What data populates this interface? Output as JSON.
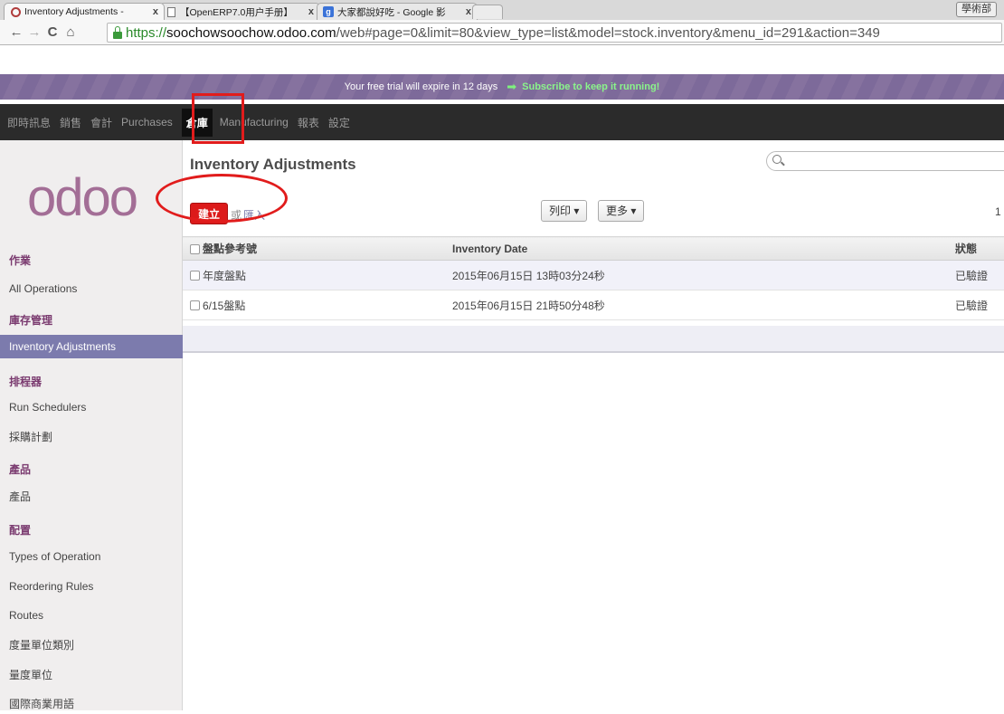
{
  "browser": {
    "tabs": [
      {
        "title": "Inventory Adjustments - ",
        "icon": "odoo-icon",
        "active": true
      },
      {
        "title": "【OpenERP7.0用户手册】",
        "icon": "document-icon",
        "active": false
      },
      {
        "title": "大家都說好吃 - Google 影",
        "icon": "google-icon",
        "active": false
      }
    ],
    "close_glyph": "x",
    "profile_badge": "學術部",
    "url": {
      "scheme": "https://",
      "host": "soochowsoochow.odoo.com",
      "path": "/web#page=0&limit=80&view_type=list&model=stock.inventory&menu_id=291&action=349"
    }
  },
  "trial": {
    "message": "Your free trial will expire in 12 days",
    "subscribe_label": "Subscribe to keep it running!"
  },
  "topmenu": [
    {
      "label": "即時訊息",
      "name": "menu-messaging"
    },
    {
      "label": "銷售",
      "name": "menu-sales"
    },
    {
      "label": "會計",
      "name": "menu-accounting"
    },
    {
      "label": "Purchases",
      "name": "menu-purchases"
    },
    {
      "label": "倉庫",
      "name": "menu-warehouse",
      "active": true
    },
    {
      "label": "Manufacturing",
      "name": "menu-manufacturing"
    },
    {
      "label": "報表",
      "name": "menu-reports"
    },
    {
      "label": "設定",
      "name": "menu-settings"
    }
  ],
  "sidebar": {
    "logo": "odoo",
    "sections": [
      {
        "title": "作業",
        "items": [
          {
            "label": "All Operations"
          }
        ]
      },
      {
        "title": "庫存管理",
        "items": [
          {
            "label": "Inventory Adjustments",
            "active": true
          }
        ]
      },
      {
        "title": "排程器",
        "items": [
          {
            "label": "Run Schedulers"
          },
          {
            "label": "採購計劃"
          }
        ]
      },
      {
        "title": "產品",
        "items": [
          {
            "label": "產品"
          }
        ]
      },
      {
        "title": "配置",
        "items": [
          {
            "label": "Types of Operation"
          },
          {
            "label": "Reordering Rules"
          },
          {
            "label": "Routes"
          },
          {
            "label": "度量單位類別"
          },
          {
            "label": "量度單位"
          },
          {
            "label": "國際商業用語"
          }
        ]
      }
    ]
  },
  "main": {
    "title": "Inventory Adjustments",
    "search_placeholder": "",
    "create_label": "建立",
    "or_label": "或",
    "import_label": "匯入",
    "print_label": "列印 ▾",
    "more_label": "更多 ▾",
    "pager": "1",
    "columns": [
      "盤點參考號",
      "Inventory Date",
      "狀態"
    ],
    "rows": [
      {
        "ref": "年度盤點",
        "date": "2015年06月15日 13時03分24秒",
        "state": "已驗證"
      },
      {
        "ref": "6/15盤點",
        "date": "2015年06月15日 21時50分48秒",
        "state": "已驗證"
      }
    ]
  },
  "colors": {
    "trial_bar": "#7d6a9a",
    "top_menu": "#2b2b2b",
    "sidebar_active": "#7c7bad",
    "create_button": "#dc1a1a",
    "annotation_red": "#e11c1c",
    "logo": "#a36e96"
  }
}
